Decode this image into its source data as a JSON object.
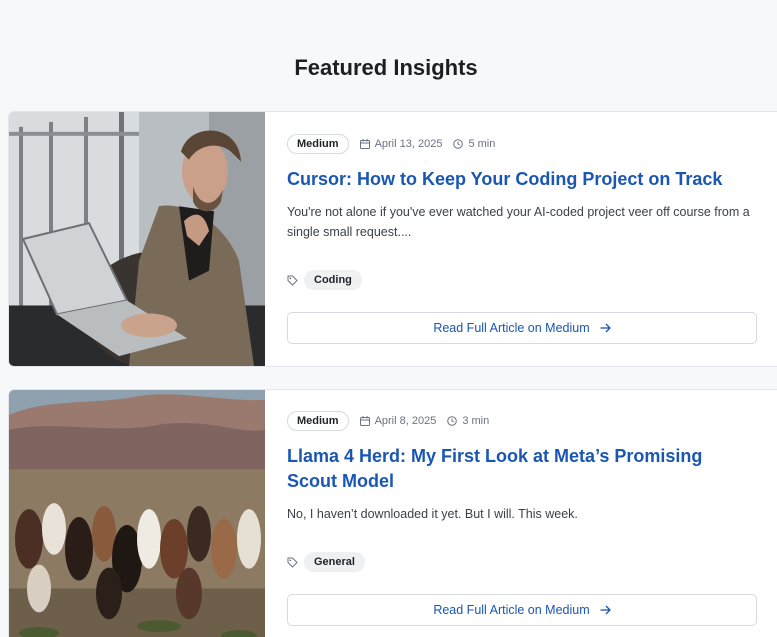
{
  "section": {
    "title": "Featured Insights"
  },
  "articles": [
    {
      "source": "Medium",
      "date": "April 13, 2025",
      "read_time": "5 min",
      "title": "Cursor: How to Keep Your Coding Project on Track",
      "excerpt": "You're not alone if you've ever watched your AI-coded project veer off course from a single small request....",
      "tag": "Coding",
      "cta": "Read Full Article on Medium",
      "image": "man-with-laptop-photo"
    },
    {
      "source": "Medium",
      "date": "April 8, 2025",
      "read_time": "3 min",
      "title": "Llama 4 Herd: My First Look at Meta’s Promising Scout Model",
      "excerpt": "No, I haven’t downloaded it yet. But I will. This week.",
      "tag": "General",
      "cta": "Read Full Article on Medium",
      "image": "llama-herd-photo"
    }
  ],
  "colors": {
    "link": "#1a56b3",
    "background": "#f7f8fa",
    "card": "#ffffff"
  },
  "icons": {
    "date": "calendar-icon",
    "time": "clock-icon",
    "tag": "tag-icon",
    "cta": "arrow-right-icon"
  }
}
